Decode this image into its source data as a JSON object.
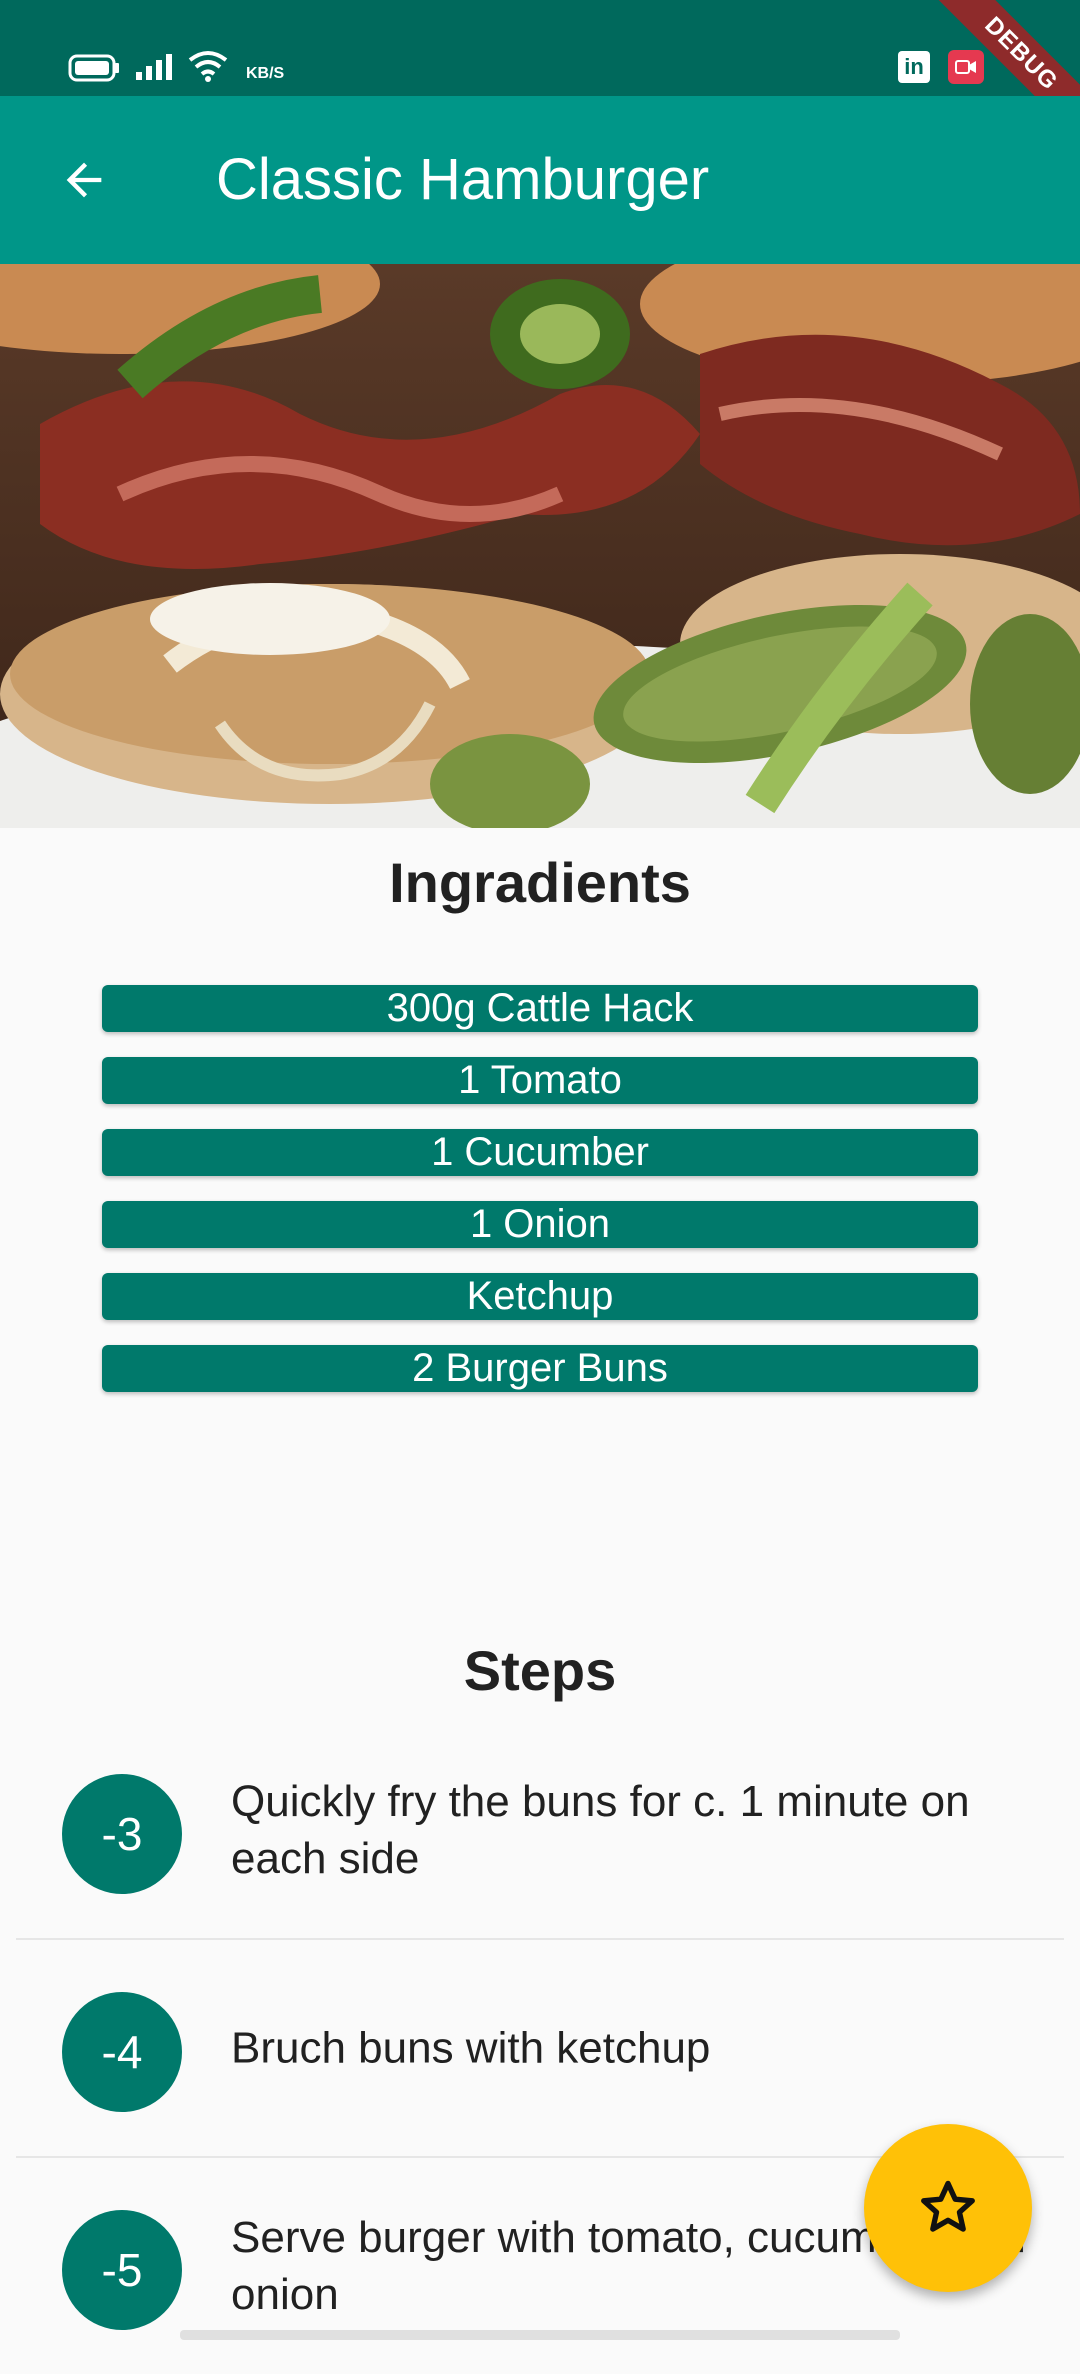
{
  "status_bar": {
    "speed_unit": "KB/S",
    "debug_label": "DEBUG",
    "icons": [
      "battery-icon",
      "signal-icon",
      "wifi-icon",
      "linkedin-icon",
      "screen-recorder-icon"
    ],
    "colors": {
      "background": "#00695c",
      "ribbon": "#8e2b2b"
    }
  },
  "app_bar": {
    "title": "Classic Hamburger",
    "back_icon": "arrow-back-icon",
    "color": "#009688"
  },
  "hero_image": {
    "subject": "hamburger with bacon, jalapeños, onion and pickles"
  },
  "ingredients": {
    "title": "Ingradients",
    "items": [
      "300g Cattle Hack",
      "1 Tomato",
      "1 Cucumber",
      "1 Onion",
      "Ketchup",
      "2 Burger Buns"
    ]
  },
  "steps": {
    "title": "Steps",
    "items": [
      {
        "number": "-3",
        "text": "Quickly fry the buns for c. 1 minute on each side"
      },
      {
        "number": "-4",
        "text": "Bruch buns with ketchup"
      },
      {
        "number": "-5",
        "text": "Serve burger with tomato, cucumber and onion"
      }
    ]
  },
  "fab": {
    "icon": "star-outline-icon",
    "color": "#ffc107"
  }
}
